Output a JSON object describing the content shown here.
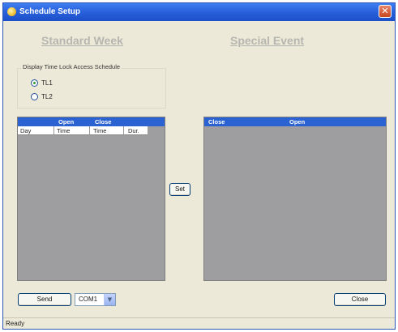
{
  "window": {
    "title": "Schedule Setup",
    "close_glyph": "✕"
  },
  "headings": {
    "standard_week": "Standard Week",
    "special_event": "Special Event"
  },
  "schedule_group": {
    "label": "Display Time Lock Access Schedule",
    "options": [
      {
        "label": "TL1",
        "selected": true
      },
      {
        "label": "TL2",
        "selected": false
      }
    ]
  },
  "standard_grid": {
    "header": [
      "Open",
      "Close"
    ],
    "subheader": [
      "Day",
      "Time",
      "Time",
      "Dur."
    ]
  },
  "special_grid": {
    "header": [
      "Close",
      "Open"
    ]
  },
  "buttons": {
    "set": "Set",
    "send": "Send",
    "close": "Close"
  },
  "port_select": {
    "value": "COM1",
    "arrow_glyph": "▼"
  },
  "status": {
    "text": "Ready"
  },
  "colors": {
    "titlebar": "#2a63dd",
    "grid_header": "#2a62d1",
    "grid_body": "#9e9da0",
    "window_bg": "#ece9d8"
  }
}
